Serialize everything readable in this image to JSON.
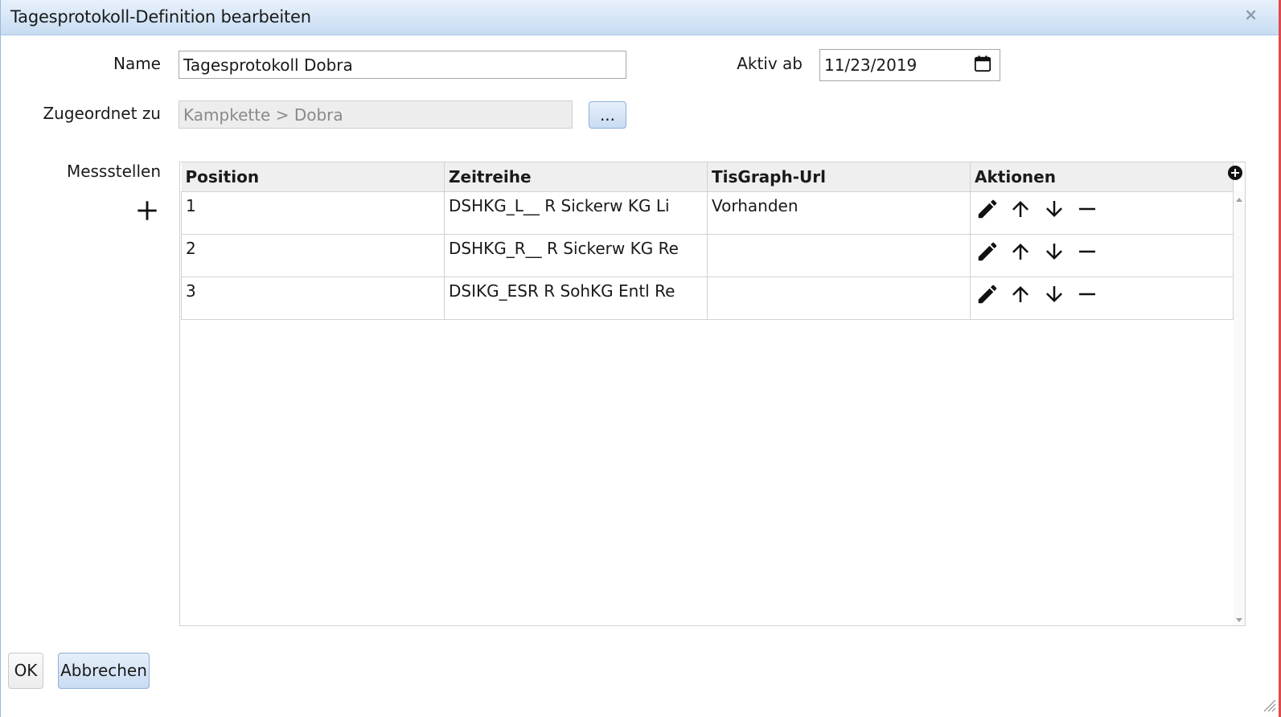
{
  "window": {
    "title": "Tagesprotokoll-Definition bearbeiten",
    "close_label": "×"
  },
  "form": {
    "name_label": "Name",
    "name_value": "Tagesprotokoll Dobra",
    "active_label": "Aktiv ab",
    "active_value": "11/23/2019",
    "assigned_label": "Zugeordnet zu",
    "assigned_value": "Kampkette > Dobra",
    "browse_label": "...",
    "messstellen_label": "Messstellen"
  },
  "table": {
    "columns": [
      "Position",
      "Zeitreihe",
      "TisGraph-Url",
      "Aktionen"
    ],
    "rows": [
      {
        "position": "1",
        "zeitreihe": "DSHKG_L__ R Sickerw KG Li",
        "url": "Vorhanden"
      },
      {
        "position": "2",
        "zeitreihe": "DSHKG_R__ R Sickerw KG Re",
        "url": ""
      },
      {
        "position": "3",
        "zeitreihe": "DSIKG_ESR R SohKG Entl Re",
        "url": ""
      }
    ]
  },
  "footer": {
    "ok_label": "OK",
    "cancel_label": "Abbrechen"
  }
}
